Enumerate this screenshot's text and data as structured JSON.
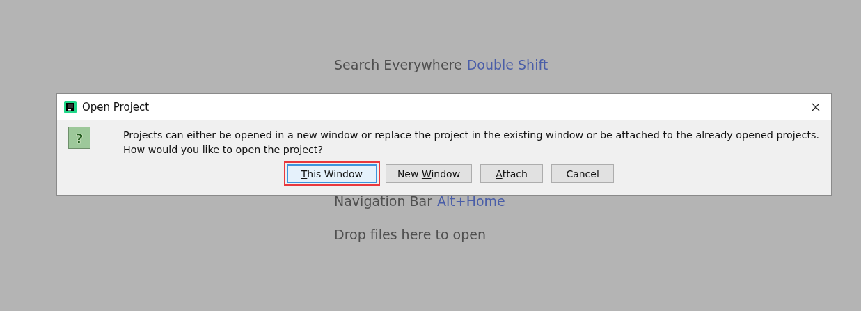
{
  "hints": [
    {
      "label": "Search Everywhere",
      "shortcut": "Double Shift"
    },
    {
      "label": "Navigation Bar",
      "shortcut": "Alt+Home"
    },
    {
      "label": "Drop files here to open"
    }
  ],
  "dialog": {
    "title": "Open Project",
    "icon_glyph": "?",
    "message": "Projects can either be opened in a new window or replace the project in the existing window or be attached to the already opened projects.\nHow would you like to open the project?",
    "buttons": [
      {
        "mnemonic": "T",
        "text_after": "his Window",
        "default": true,
        "highlighted": true
      },
      {
        "text_before": "New ",
        "mnemonic": "W",
        "text_after": "indow",
        "default": false,
        "highlighted": false
      },
      {
        "mnemonic": "A",
        "text_after": "ttach",
        "default": false,
        "highlighted": false
      },
      {
        "text_before": "Cancel",
        "default": false,
        "highlighted": false
      }
    ]
  }
}
